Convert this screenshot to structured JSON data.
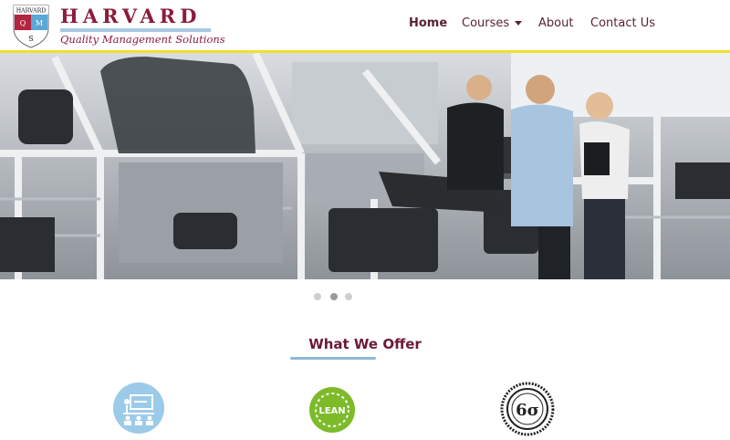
{
  "header": {
    "crest": {
      "top": "HARVARD",
      "letters": [
        "Q",
        "M",
        "S"
      ]
    },
    "brand_name": "HARVARD",
    "tagline": "Quality Management Solutions"
  },
  "nav": {
    "items": [
      {
        "label": "Home",
        "active": true
      },
      {
        "label": "Courses",
        "has_dropdown": true
      },
      {
        "label": "About"
      },
      {
        "label": "Contact Us"
      }
    ]
  },
  "hero": {
    "slide_count": 3,
    "active_slide": 2
  },
  "offer": {
    "title": "What We Offer",
    "icons": [
      {
        "name": "training-icon"
      },
      {
        "name": "lean-icon",
        "label": "LEAN"
      },
      {
        "name": "six-sigma-icon",
        "label": "6σ"
      }
    ]
  },
  "colors": {
    "brand": "#8a1c3a",
    "accent_yellow": "#f2df2a",
    "accent_blue": "#8fb9d8",
    "lean_green": "#7dbb2a"
  }
}
